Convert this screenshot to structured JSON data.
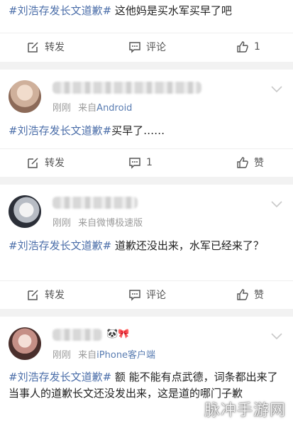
{
  "posts": [
    {
      "text_tag": "#刘浩存发长文道歉#",
      "text_body": " 这他妈是买水军买早了吧",
      "actions": {
        "repost": "转发",
        "comment": "评论",
        "like": "1"
      }
    },
    {
      "time": "刚刚",
      "source_prefix": "来自",
      "source": "Android",
      "text_tag": "#刘浩存发长文道歉#",
      "text_body": "买早了……",
      "actions": {
        "repost": "转发",
        "comment": "1",
        "like": "赞"
      }
    },
    {
      "time": "刚刚",
      "source_prefix": "来自",
      "source": "微博极速版",
      "text_tag": "#刘浩存发长文道歉#",
      "text_body": "  道歉还没出来，水军已经来了？",
      "actions": {
        "repost": "转发",
        "comment": "评论",
        "like": "赞"
      }
    },
    {
      "time": "刚刚",
      "source_prefix": "来自",
      "source": "iPhone客户端",
      "text_tag": "#刘浩存发长文道歉#",
      "text_body": " 额 能不能有点武德，词条都出来了当事人的道歉长文还没发出来，这是道的哪门子歉",
      "actions": {}
    }
  ],
  "watermark": "脉冲手游网",
  "icons": {
    "repost": "edit-square-icon",
    "comment": "comment-bubble-icon",
    "like": "thumbs-up-icon",
    "more": "chevron-down-icon"
  },
  "colors": {
    "hashtag": "#4b6ea9",
    "source_link": "#5a7db2",
    "meta": "#9b9b9b"
  }
}
